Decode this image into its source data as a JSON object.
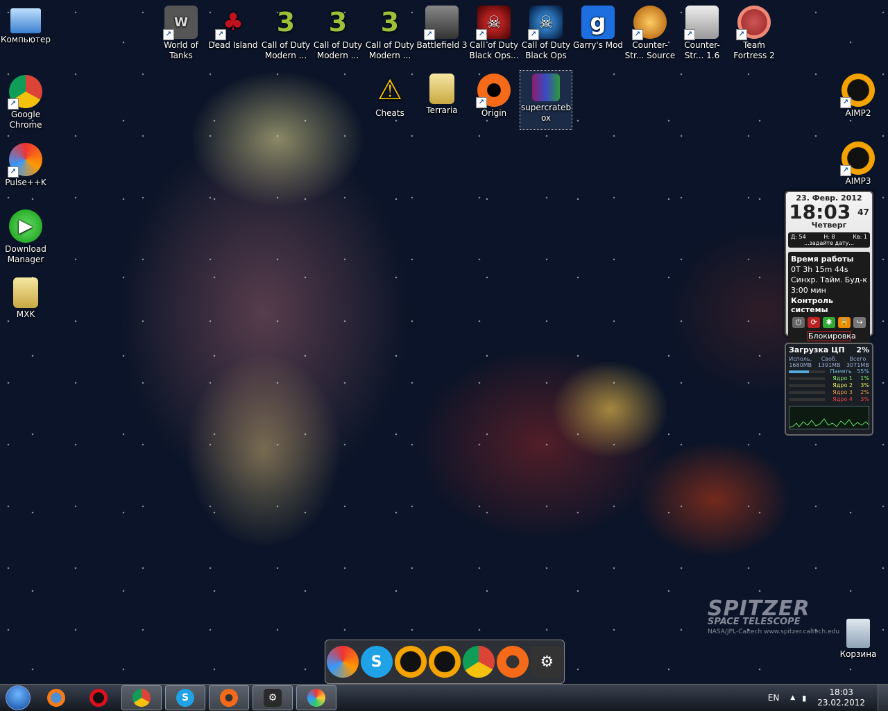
{
  "desktop": {
    "icons": [
      {
        "label": "Компьютер"
      },
      {
        "label": "Google Chrome"
      },
      {
        "label": "Pulse++K"
      },
      {
        "label": "Download Manager"
      },
      {
        "label": "MXK"
      },
      {
        "label": "World of Tanks"
      },
      {
        "label": "Dead Island"
      },
      {
        "label": "Call of Duty Modern ..."
      },
      {
        "label": "Call of Duty Modern ..."
      },
      {
        "label": "Call of Duty Modern ..."
      },
      {
        "label": "Battlefield 3"
      },
      {
        "label": "Call of Duty Black Ops..."
      },
      {
        "label": "Call of Duty Black Ops"
      },
      {
        "label": "Garry's Mod"
      },
      {
        "label": "Counter-Str... Source"
      },
      {
        "label": "Counter-Str... 1.6"
      },
      {
        "label": "Team Fortress 2"
      },
      {
        "label": "Cheats"
      },
      {
        "label": "Terraria"
      },
      {
        "label": "Origin"
      },
      {
        "label": "supercratebox"
      },
      {
        "label": "AIMP2"
      },
      {
        "label": "AIMP3"
      },
      {
        "label": "Корзина"
      }
    ],
    "icon_glyphs": {
      "cod": "3",
      "garrys": "g"
    }
  },
  "clock_gadget": {
    "date": "23. Февр. 2012",
    "time": "18:03",
    "seconds": "47",
    "weekday": "Четверг",
    "stats_d": "Д: 54",
    "stats_n": "Н: 8",
    "stats_kv": "Кв: 1",
    "set_date": "...задайте дату...",
    "uptime_label": "Время работы",
    "uptime": "0Т 3h 15m 44s",
    "sync": "Синхр.",
    "timer": "Тайм.",
    "alarm": "Буд-к",
    "timer_value": "3:00 мин",
    "system_control": "Контроль системы",
    "lock": "Блокировка"
  },
  "cpu_gadget": {
    "title": "Загрузка ЦП",
    "percent": "2%",
    "used_label": "Исполь.",
    "free_label": "Своб.",
    "total_label": "Всего",
    "used": "1680MB",
    "free": "1391MB",
    "total": "3071MB",
    "rows": [
      {
        "label": "Память",
        "value": "55%"
      },
      {
        "label": "Ядро 1",
        "value": "1%"
      },
      {
        "label": "Ядро 2",
        "value": "3%"
      },
      {
        "label": "Ядро 3",
        "value": "2%"
      },
      {
        "label": "Ядро 4",
        "value": "3%"
      }
    ],
    "memory_level": 0.55
  },
  "watermark": {
    "title": "SPITZER",
    "subtitle": "SPACE TELESCOPE",
    "credit": "NASA/JPL-Caltech    www.spitzer.caltech.edu"
  },
  "taskbar": {
    "language": "EN",
    "time": "18:03",
    "date": "23.02.2012"
  },
  "colors": {
    "accent": "#1a5fb4"
  }
}
